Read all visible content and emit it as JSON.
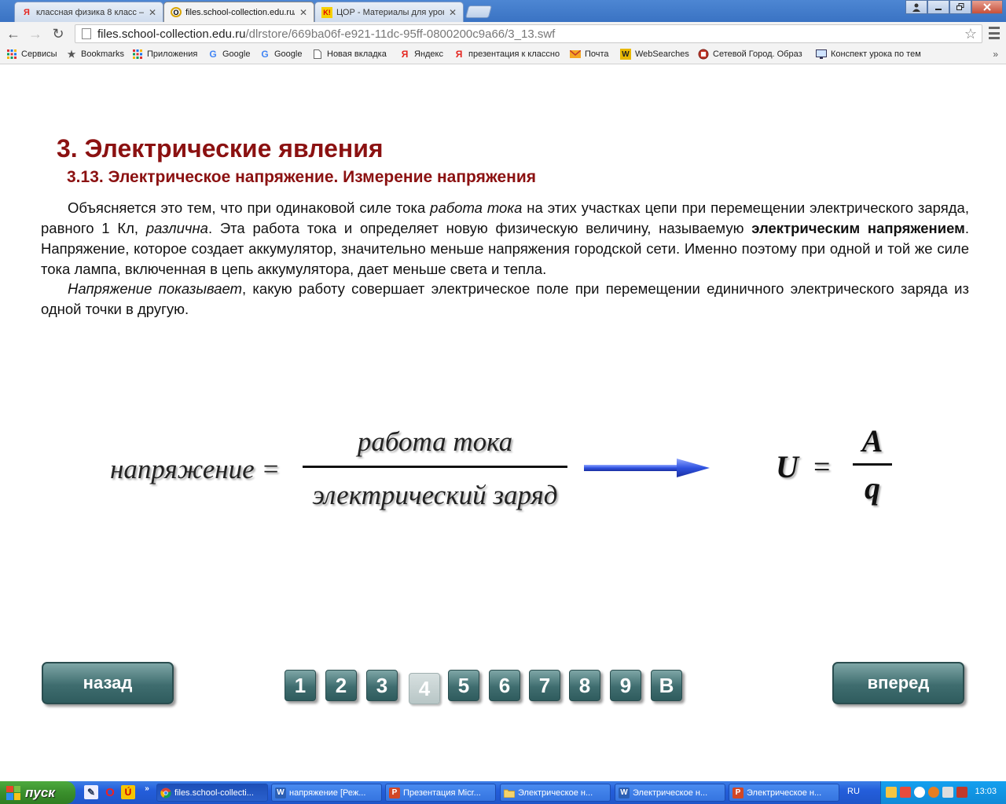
{
  "browser": {
    "tabs": [
      {
        "label": "классная физика 8 класс –",
        "icon": "Я",
        "active": false
      },
      {
        "label": "files.school-collection.edu.ru/",
        "icon": "O",
        "active": true
      },
      {
        "label": "ЦОР - Материалы для урок",
        "icon": "K!",
        "active": false
      }
    ],
    "window_controls": [
      "user-icon",
      "minimize-icon",
      "restore-icon",
      "close-icon"
    ],
    "address": {
      "host": "files.school-collection.edu.ru",
      "path": "/dlrstore/669ba06f-e921-11dc-95ff-0800200c9a66/3_13.swf"
    },
    "bookmarks": [
      {
        "label": "Сервисы",
        "icon": "apps-grid-icon"
      },
      {
        "label": "Bookmarks",
        "icon": "star-icon"
      },
      {
        "label": "Приложения",
        "icon": "apps-grid-icon"
      },
      {
        "label": "Google",
        "icon": "google-icon"
      },
      {
        "label": "Google",
        "icon": "google-icon"
      },
      {
        "label": "Новая вкладка",
        "icon": "page-icon"
      },
      {
        "label": "Яндекс",
        "icon": "yandex-icon"
      },
      {
        "label": "презентация к классно",
        "icon": "yandex-icon"
      },
      {
        "label": "Почта",
        "icon": "mail-icon"
      },
      {
        "label": "WebSearches",
        "icon": "websearch-icon"
      },
      {
        "label": "Сетевой Город. Образ",
        "icon": "school-icon"
      },
      {
        "label": "Конспект урока по тем",
        "icon": "monitor-icon"
      }
    ]
  },
  "page": {
    "title": "3. Электрические явления",
    "subtitle": "3.13. Электрическое напряжение. Измерение напряжения",
    "p1": {
      "t1": "Объясняется это тем, что при одинаковой силе тока ",
      "t1_em": "работа тока",
      "t2": " на этих участках цепи при перемещении электрического заряда, равного 1 Кл, ",
      "t2_em": "различна",
      "t3": ". Эта работа тока и определяет новую физическую величину, называемую ",
      "t3_b": "электрическим напряжением",
      "t4": ". Напряжение, которое создает аккумулятор, значительно меньше напряжения городской сети. Именно поэтому при одной и той же силе тока лампа, включенная в цепь аккумулятора, дает меньше света и тепла."
    },
    "p2": {
      "t1_em": "Напряжение показывает",
      "t2": ", какую работу совершает электрическое поле при перемещении единичного электрического заряда из одной точки в другую."
    },
    "formula": {
      "left": "напряжение =",
      "numerator": "работа тока",
      "denominator": "электрический заряд",
      "symbol_lhs": "U",
      "symbol_eq": "=",
      "symbol_num": "A",
      "symbol_den": "q",
      "arrow_color": "#2f52e0"
    },
    "nav": {
      "back": "назад",
      "forward": "вперед",
      "pages": [
        "1",
        "2",
        "3",
        "4",
        "5",
        "6",
        "7",
        "8",
        "9",
        "В"
      ],
      "current_page": "4"
    }
  },
  "taskbar": {
    "start": "пуск",
    "quicklaunch": [
      "notepad-icon",
      "opera-icon",
      "mail-u-icon"
    ],
    "tasks": [
      {
        "label": "files.school-collecti...",
        "icon": "chrome-icon",
        "active": true
      },
      {
        "label": "напряжение [Реж...",
        "icon": "word-icon",
        "active": false
      },
      {
        "label": "Презентация Micr...",
        "icon": "powerpoint-icon",
        "active": false
      },
      {
        "label": "Электрическое н...",
        "icon": "folder-icon",
        "active": false
      },
      {
        "label": "Электрическое н...",
        "icon": "word-icon",
        "active": false
      },
      {
        "label": "Электрическое н...",
        "icon": "powerpoint-icon",
        "active": false
      }
    ],
    "lang": "RU",
    "clock": "13:03"
  }
}
